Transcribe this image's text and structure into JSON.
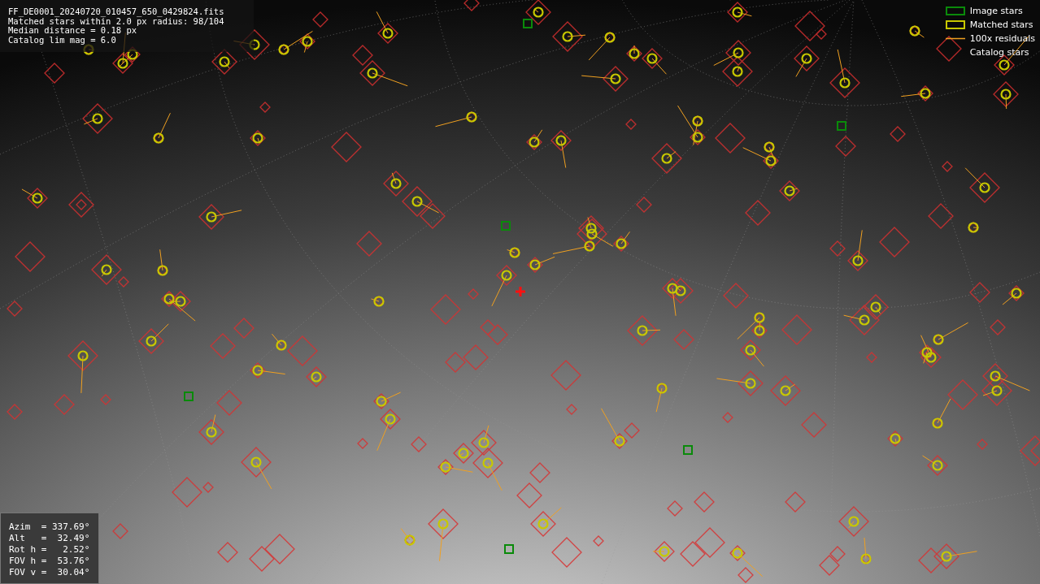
{
  "info": {
    "lines": [
      "FF_DE0001_20240720_010457_650_0429824.fits",
      "Matched stars within 2.0 px radius: 98/104",
      "Median distance = 0.18 px",
      "Catalog lim mag = 6.0"
    ]
  },
  "legend": [
    {
      "kind": "image",
      "label": "Image stars"
    },
    {
      "kind": "matched",
      "label": "Matched stars"
    },
    {
      "kind": "residual",
      "label": "100x residuals"
    },
    {
      "kind": "catalog",
      "label": "Catalog stars"
    }
  ],
  "pointing": {
    "lines": [
      "Azim  = 337.69°",
      "Alt   =  32.49°",
      "Rot h =   2.52°",
      "FOV h =  53.76°",
      "FOV v =  30.04°"
    ]
  }
}
